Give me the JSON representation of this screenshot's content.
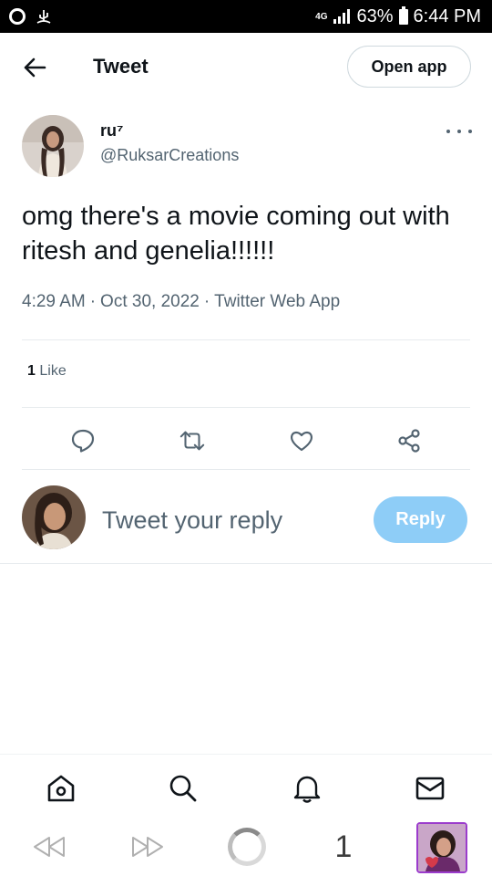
{
  "status_bar": {
    "network": "4G",
    "battery": "63%",
    "time": "6:44 PM"
  },
  "header": {
    "title": "Tweet",
    "open_app_label": "Open app"
  },
  "tweet": {
    "author_name": "ru⁷",
    "author_handle": "@RuksarCreations",
    "text": "omg there's a movie coming out with ritesh and genelia!!!!!!",
    "time": "4:29 AM",
    "date": "Oct 30, 2022",
    "source": "Twitter Web App",
    "separator": "·",
    "like_count": "1",
    "like_label": "Like"
  },
  "reply": {
    "placeholder": "Tweet your reply",
    "button_label": "Reply"
  },
  "browser": {
    "tab_count": "1"
  },
  "colors": {
    "accent_disabled": "#8ecdf7",
    "muted_text": "#536471",
    "primary_text": "#0f1419"
  },
  "icons": {
    "back": "arrow-left-icon",
    "more": "more-dots-icon",
    "reply": "comment-icon",
    "retweet": "retweet-icon",
    "like": "heart-icon",
    "share": "share-icon",
    "home": "home-icon",
    "search": "search-icon",
    "notifications": "bell-icon",
    "messages": "mail-icon"
  }
}
